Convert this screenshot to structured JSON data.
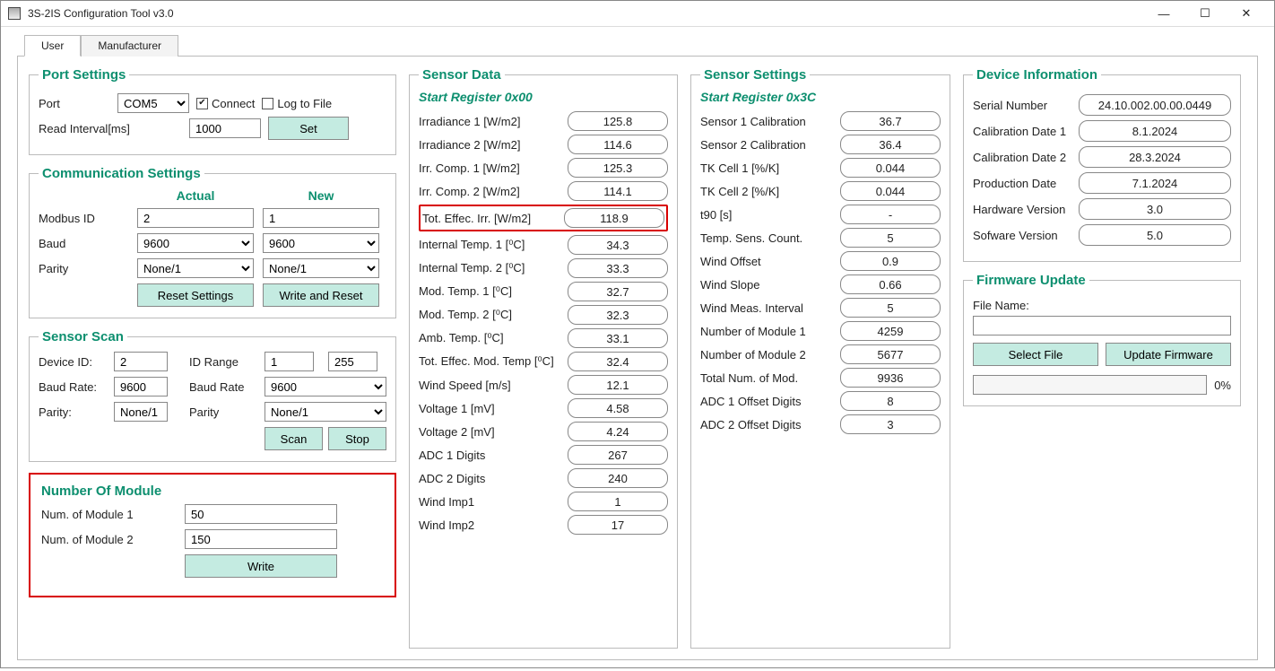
{
  "window": {
    "title": "3S-2IS Configuration Tool v3.0",
    "minimize": "—",
    "maximize": "☐",
    "close": "✕"
  },
  "tabs": {
    "user": "User",
    "manufacturer": "Manufacturer"
  },
  "port_settings": {
    "legend": "Port Settings",
    "port_label": "Port",
    "port_value": "COM5",
    "connect_label": "Connect",
    "log_label": "Log to File",
    "read_interval_label": "Read Interval[ms]",
    "read_interval_value": "1000",
    "set_btn": "Set"
  },
  "comm": {
    "legend": "Communication Settings",
    "actual": "Actual",
    "new": "New",
    "modbus_label": "Modbus ID",
    "modbus_actual": "2",
    "modbus_new": "1",
    "baud_label": "Baud",
    "baud_actual": "9600",
    "baud_new": "9600",
    "parity_label": "Parity",
    "parity_actual": "None/1",
    "parity_new": "None/1",
    "reset_btn": "Reset Settings",
    "write_btn": "Write and Reset"
  },
  "scan": {
    "legend": "Sensor Scan",
    "device_id_lbl": "Device ID:",
    "device_id": "2",
    "id_range_lbl": "ID Range",
    "id_from": "1",
    "id_to": "255",
    "baud_lbl": "Baud Rate:",
    "baud": "9600",
    "baud_lbl2": "Baud Rate",
    "baud2": "9600",
    "parity_lbl": "Parity:",
    "parity": "None/1",
    "parity_lbl2": "Parity",
    "parity2": "None/1",
    "scan_btn": "Scan",
    "stop_btn": "Stop"
  },
  "nummod": {
    "legend": "Number Of Module",
    "m1_lbl": "Num. of Module 1",
    "m1": "50",
    "m2_lbl": "Num. of Module 2",
    "m2": "150",
    "write_btn": "Write"
  },
  "sensor_data": {
    "legend": "Sensor Data",
    "sub": "Start Register 0x00",
    "rows": [
      {
        "k": "Irradiance 1 [W/m2]",
        "v": "125.8"
      },
      {
        "k": "Irradiance 2 [W/m2]",
        "v": "114.6"
      },
      {
        "k": "Irr. Comp. 1 [W/m2]",
        "v": "125.3"
      },
      {
        "k": "Irr. Comp. 2 [W/m2]",
        "v": "114.1"
      },
      {
        "k": "Tot. Effec. Irr. [W/m2]",
        "v": "118.9",
        "hl": true
      },
      {
        "k": "Internal Temp. 1 [⁰C]",
        "v": "34.3"
      },
      {
        "k": "Internal Temp. 2 [⁰C]",
        "v": "33.3"
      },
      {
        "k": "Mod. Temp. 1 [⁰C]",
        "v": "32.7"
      },
      {
        "k": "Mod. Temp. 2 [⁰C]",
        "v": "32.3"
      },
      {
        "k": "Amb. Temp. [⁰C]",
        "v": "33.1"
      },
      {
        "k": "Tot. Effec. Mod. Temp [⁰C]",
        "v": "32.4"
      },
      {
        "k": "Wind Speed [m/s]",
        "v": "12.1"
      },
      {
        "k": "Voltage 1 [mV]",
        "v": "4.58"
      },
      {
        "k": "Voltage 2 [mV]",
        "v": "4.24"
      },
      {
        "k": "ADC 1 Digits",
        "v": "267"
      },
      {
        "k": "ADC 2 Digits",
        "v": "240"
      },
      {
        "k": "Wind Imp1",
        "v": "1"
      },
      {
        "k": "Wind Imp2",
        "v": "17"
      }
    ]
  },
  "sensor_settings": {
    "legend": "Sensor Settings",
    "sub": "Start Register 0x3C",
    "rows": [
      {
        "k": "Sensor 1 Calibration",
        "v": "36.7"
      },
      {
        "k": "Sensor 2 Calibration",
        "v": "36.4"
      },
      {
        "k": "TK Cell 1 [%/K]",
        "v": "0.044"
      },
      {
        "k": "TK Cell 2 [%/K]",
        "v": "0.044"
      },
      {
        "k": "t90 [s]",
        "v": "-"
      },
      {
        "k": "Temp. Sens. Count.",
        "v": "5"
      },
      {
        "k": "Wind Offset",
        "v": "0.9"
      },
      {
        "k": "Wind Slope",
        "v": "0.66"
      },
      {
        "k": "Wind Meas. Interval",
        "v": "5"
      },
      {
        "k": "Number of Module 1",
        "v": "4259"
      },
      {
        "k": "Number of Module 2",
        "v": "5677"
      },
      {
        "k": "Total Num. of Mod.",
        "v": "9936"
      },
      {
        "k": "ADC 1 Offset Digits",
        "v": "8"
      },
      {
        "k": "ADC 2 Offset Digits",
        "v": "3"
      }
    ]
  },
  "device_info": {
    "legend": "Device Information",
    "rows": [
      {
        "k": "Serial Number",
        "v": "24.10.002.00.00.0449"
      },
      {
        "k": "Calibration Date 1",
        "v": "8.1.2024"
      },
      {
        "k": "Calibration Date 2",
        "v": "28.3.2024"
      },
      {
        "k": "Production Date",
        "v": "7.1.2024"
      },
      {
        "k": "Hardware Version",
        "v": "3.0"
      },
      {
        "k": "Sofware Version",
        "v": "5.0"
      }
    ]
  },
  "firmware": {
    "legend": "Firmware Update",
    "file_lbl": "File Name:",
    "file": "",
    "select_btn": "Select File",
    "update_btn": "Update Firmware",
    "pct": "0%"
  }
}
